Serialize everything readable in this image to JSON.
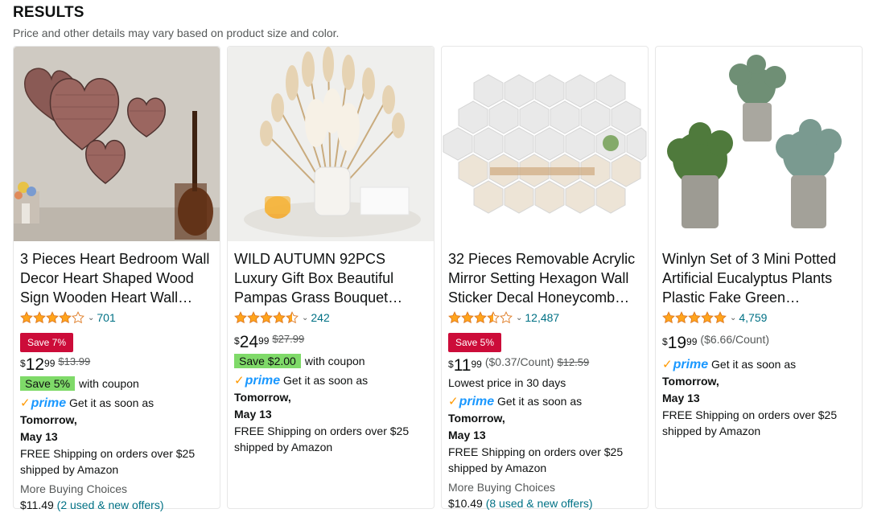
{
  "header": {
    "title": "RESULTS",
    "subtitle": "Price and other details may vary based on product size and color."
  },
  "colors": {
    "accent_link": "#007185",
    "save_badge": "#cc0c39",
    "coupon": "#7fda69",
    "star": "#ffa41c",
    "prime": "#1a98ff"
  },
  "products": [
    {
      "title": "3 Pieces Heart Bedroom Wall Decor Heart Shaped Wood Sign Wooden Heart Wall Hanging",
      "rating": 4.0,
      "rating_count": "701",
      "save_badge": "Save 7%",
      "price_symbol": "$",
      "price_whole": "12",
      "price_fraction": "99",
      "old_price": "$13.99",
      "coupon": "Save 5%",
      "coupon_suffix": "with coupon",
      "prime_text": "prime",
      "delivery_prefix": "Get it as soon as",
      "delivery_day": "Tomorrow,",
      "delivery_date": "May 13",
      "shipping_line1": "FREE Shipping on orders over $25",
      "shipping_line2": "shipped by Amazon",
      "more_choices": "More Buying Choices",
      "more_price": "$11.49",
      "offers": "(2 used & new offers)"
    },
    {
      "title": "WILD AUTUMN 92PCS Luxury Gift Box Beautiful Pampas Grass Bouquet Natural Dried",
      "rating": 4.5,
      "rating_count": "242",
      "price_symbol": "$",
      "price_whole": "24",
      "price_fraction": "99",
      "old_price": "$27.99",
      "coupon": "Save $2.00",
      "coupon_suffix": "with coupon",
      "prime_text": "prime",
      "delivery_prefix": "Get it as soon as",
      "delivery_day": "Tomorrow,",
      "delivery_date": "May 13",
      "shipping_line1": "FREE Shipping on orders over $25",
      "shipping_line2": "shipped by Amazon"
    },
    {
      "title": "32 Pieces Removable Acrylic Mirror Setting Hexagon Wall Sticker Decal Honeycomb Mirror",
      "rating": 3.5,
      "rating_count": "12,487",
      "save_badge": "Save 5%",
      "price_symbol": "$",
      "price_whole": "11",
      "price_fraction": "99",
      "unit_price": "($0.37/Count)",
      "old_price": "$12.59",
      "lowest_note": "Lowest price in 30 days",
      "prime_text": "prime",
      "delivery_prefix": "Get it as soon as",
      "delivery_day": "Tomorrow,",
      "delivery_date": "May 13",
      "shipping_line1": "FREE Shipping on orders over $25",
      "shipping_line2": "shipped by Amazon",
      "more_choices": "More Buying Choices",
      "more_price": "$10.49",
      "offers": "(8 used & new offers)"
    },
    {
      "title": "Winlyn Set of 3 Mini Potted Artificial Eucalyptus Plants Plastic Fake Green Rosemary Plants",
      "rating": 5.0,
      "rating_count": "4,759",
      "price_symbol": "$",
      "price_whole": "19",
      "price_fraction": "99",
      "unit_price": "($6.66/Count)",
      "prime_text": "prime",
      "delivery_prefix": "Get it as soon as",
      "delivery_day": "Tomorrow,",
      "delivery_date": "May 13",
      "shipping_line1": "FREE Shipping on orders over $25",
      "shipping_line2": "shipped by Amazon"
    }
  ]
}
